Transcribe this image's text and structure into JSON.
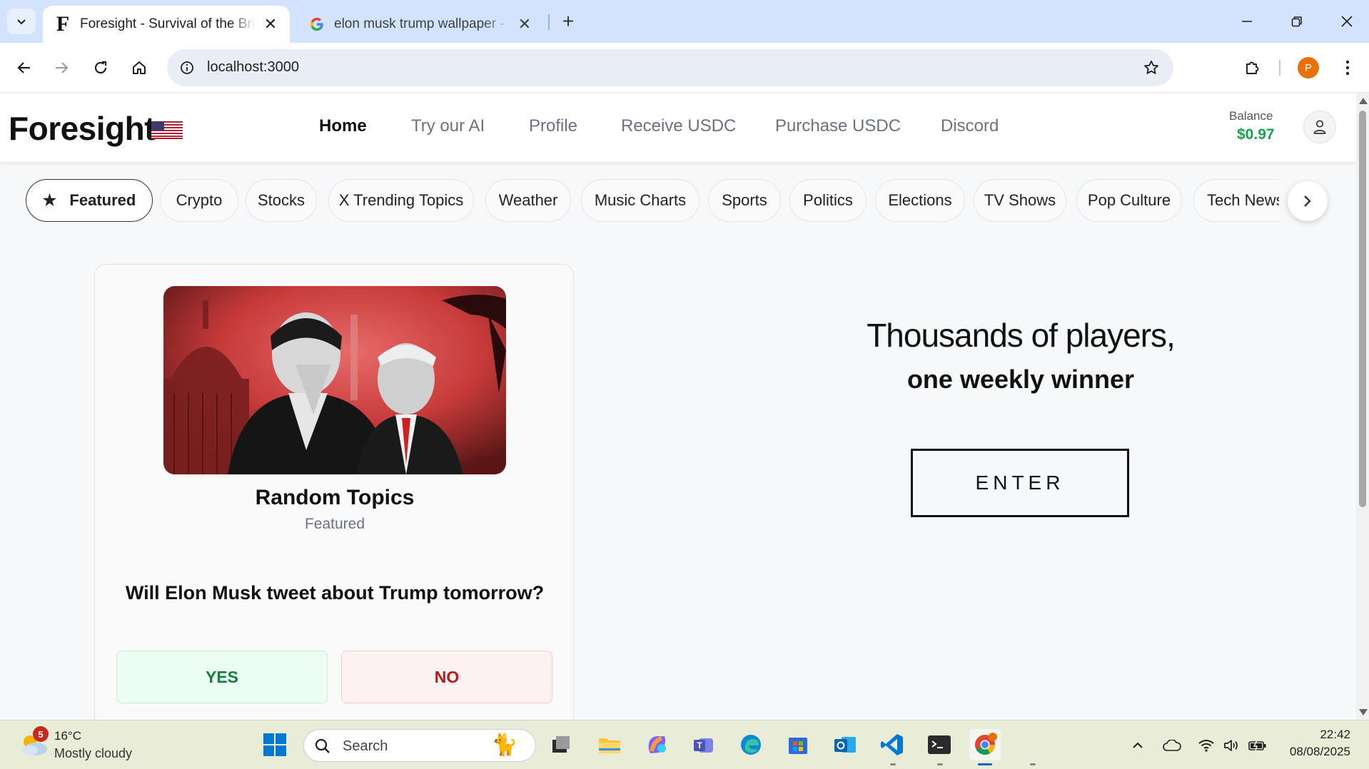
{
  "browser": {
    "tabs": [
      {
        "title": "Foresight - Survival of the Brightest",
        "favicon": "F",
        "active": true
      },
      {
        "title": "elon musk trump wallpaper - Google Search",
        "favicon": "google-icon",
        "active": false
      }
    ],
    "url": "localhost:3000",
    "profile_initial": "P"
  },
  "app": {
    "logo": "Foresight",
    "nav": [
      "Home",
      "Try our AI",
      "Profile",
      "Receive USDC",
      "Purchase USDC",
      "Discord"
    ],
    "active_nav": "Home",
    "balance_label": "Balance",
    "balance_value": "$0.97",
    "balance_color": "#16a34a"
  },
  "categories": [
    "Featured",
    "Crypto",
    "Stocks",
    "X Trending Topics",
    "Weather",
    "Music Charts",
    "Sports",
    "Politics",
    "Elections",
    "TV Shows",
    "Pop Culture",
    "Tech News"
  ],
  "card": {
    "title": "Random Topics",
    "subtitle": "Featured",
    "question": "Will Elon Musk tweet about Trump tomorrow?",
    "yes_label": "YES",
    "no_label": "NO"
  },
  "hero": {
    "line1": "Thousands of players,",
    "line2": "one weekly winner",
    "cta": "ENTER"
  },
  "taskbar": {
    "weather_badge": "5",
    "temperature": "16°C",
    "condition": "Mostly cloudy",
    "search_placeholder": "Search",
    "time": "22:42",
    "date": "08/08/2025"
  }
}
